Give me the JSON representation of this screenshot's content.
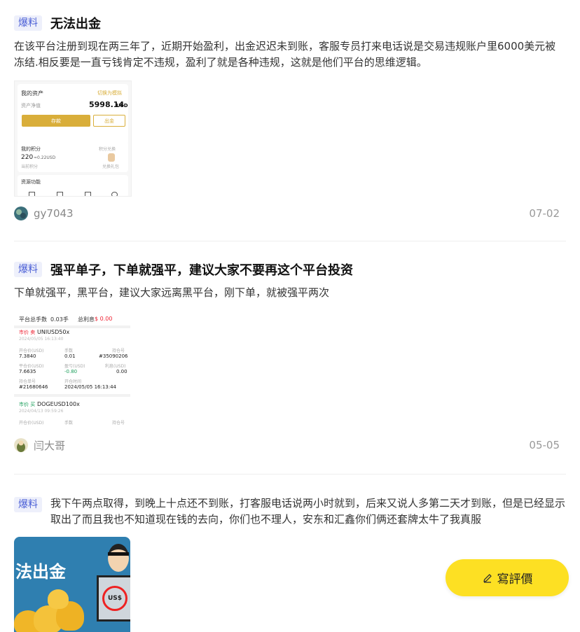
{
  "posts": [
    {
      "tag": "爆料",
      "title": "无法出金",
      "body": "在该平台注册到现在两三年了，近期开始盈利，出金迟迟未到账，客服专员打来电话说是交易违规账户里6000美元被冻结.相反要是一直亏钱肯定不违规，盈利了就是各种违规，这就是他们平台的思维逻辑。",
      "author": "gy7043",
      "date": "07-02",
      "thumb": {
        "asset_label": "我的资产",
        "link_label": "切换为模拟",
        "equity_label": "资产净值",
        "equity_value": "5998.14",
        "equity_unit": "USD",
        "deposit_btn": "存款",
        "withdraw_btn": "出金",
        "points_label": "我的积分",
        "points_right": "积分兑换",
        "points_value": "220",
        "points_sub": "≈0.22USD",
        "points_caption": "当前积分",
        "gift_caption": "兑换礼包",
        "features_label": "资源功能"
      }
    },
    {
      "tag": "爆料",
      "title": "强平单子，下单就强平，建议大家不要再这个平台投资",
      "body": "下单就强平，黑平台，建议大家远离黑平台，刚下单，就被强平两次",
      "author": "闫大哥",
      "date": "05-05",
      "thumb": {
        "header_left": "平台总手数",
        "header_left_val": "0.03手",
        "header_right": "总利息",
        "header_right_val": "$ 0.00",
        "row1_title": "UNIUSD50x",
        "row1_title_prefix": "市价 卖",
        "row1_date": "2024/05/05 16:13:40",
        "c1": "开仓价(USD)",
        "c1v": "7.3840",
        "c2": "手数",
        "c2v": "0.01",
        "c3": "持仓号",
        "c3v": "#35090206",
        "c4": "平仓价(USD)",
        "c4v": "7.6635",
        "c5": "盈亏(USD)",
        "c5v": "-0.80",
        "c6": "利息(USD)",
        "c6v": "0.00",
        "c7": "持仓单号",
        "c7v": "#21680646",
        "c8": "开仓时间",
        "c8v": "2024/05/05 16:13:44",
        "row2_title_prefix": "市价 买",
        "row2_title": "DOGEUSD100x",
        "row2_date": "2024/04/13 09:59:26",
        "c9": "开仓价(USD)",
        "c10": "手数",
        "c11": "持仓号"
      }
    },
    {
      "tag": "爆料",
      "body": "我下午两点取得，到晚上十点还不到账，打客服电话说两小时就到，后来又说人多第二天才到账，但是已经显示取出了而且我也不知道现在钱的去向，你们也不理人，安东和汇鑫你们俩还套牌太牛了我真服",
      "thumb_text": "法出金",
      "thumb_sign": "US$"
    }
  ],
  "write_button": {
    "label": "寫評價",
    "icon": "pencil-icon"
  },
  "colors": {
    "tag_bg": "#eef0fb",
    "tag_text": "#4b5fd6",
    "button_bg": "#fde023",
    "thumb_gold": "#d9ae3a"
  }
}
